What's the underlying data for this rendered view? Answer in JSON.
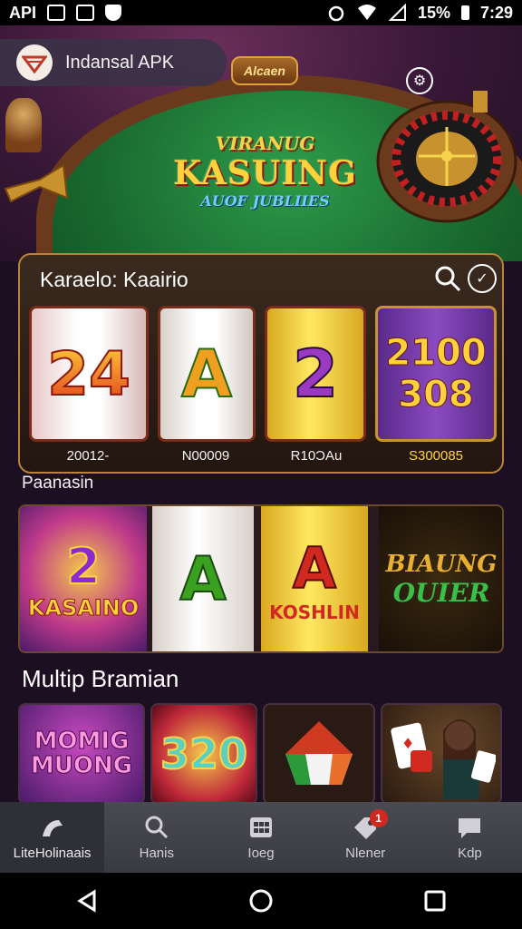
{
  "status_bar": {
    "carrier": "API",
    "battery": "15%",
    "time": "7:29"
  },
  "header": {
    "app_title": "Indansal APK",
    "ticket_label": "Alcaen"
  },
  "hero": {
    "logo_top": "VIRANUG",
    "logo_main": "KASUING",
    "logo_bottom": "AUOF JUBLIIES"
  },
  "panel": {
    "title": "Karaelo: Kaairio",
    "reels": [
      {
        "symbol": "24",
        "value": "20012-"
      },
      {
        "symbol": "A",
        "value": "N00009"
      },
      {
        "symbol": "2",
        "value": "R10ƆAu"
      },
      {
        "symbol_top": "2100",
        "symbol_bottom": "308",
        "value": "S300085"
      }
    ]
  },
  "section_label": "Paanasin",
  "row2": {
    "tiles": [
      {
        "big": "2",
        "text": "KASAINO"
      },
      {
        "big": "A",
        "text": ""
      },
      {
        "big": "A",
        "text": "KOSHLIN"
      },
      {
        "big": "BIAUNG",
        "text": "OUIER"
      }
    ]
  },
  "section_title": "Multip Bramian",
  "row3": {
    "cards": [
      {
        "text": "MOMIG MUONG"
      },
      {
        "text": "320"
      },
      {
        "text": ""
      },
      {
        "text": ""
      }
    ]
  },
  "bottom_nav": {
    "items": [
      {
        "label": "LiteHolinaais",
        "icon": "home-icon"
      },
      {
        "label": "Hanis",
        "icon": "search-icon"
      },
      {
        "label": "Ioeg",
        "icon": "grid-icon"
      },
      {
        "label": "Nlener",
        "icon": "tag-icon",
        "badge": "1"
      },
      {
        "label": "Kdp",
        "icon": "chat-icon"
      }
    ]
  },
  "colors": {
    "gold": "#ffd23c",
    "felt": "#1a6b30",
    "panel_border": "#b8843a",
    "background": "#1d0f22"
  }
}
